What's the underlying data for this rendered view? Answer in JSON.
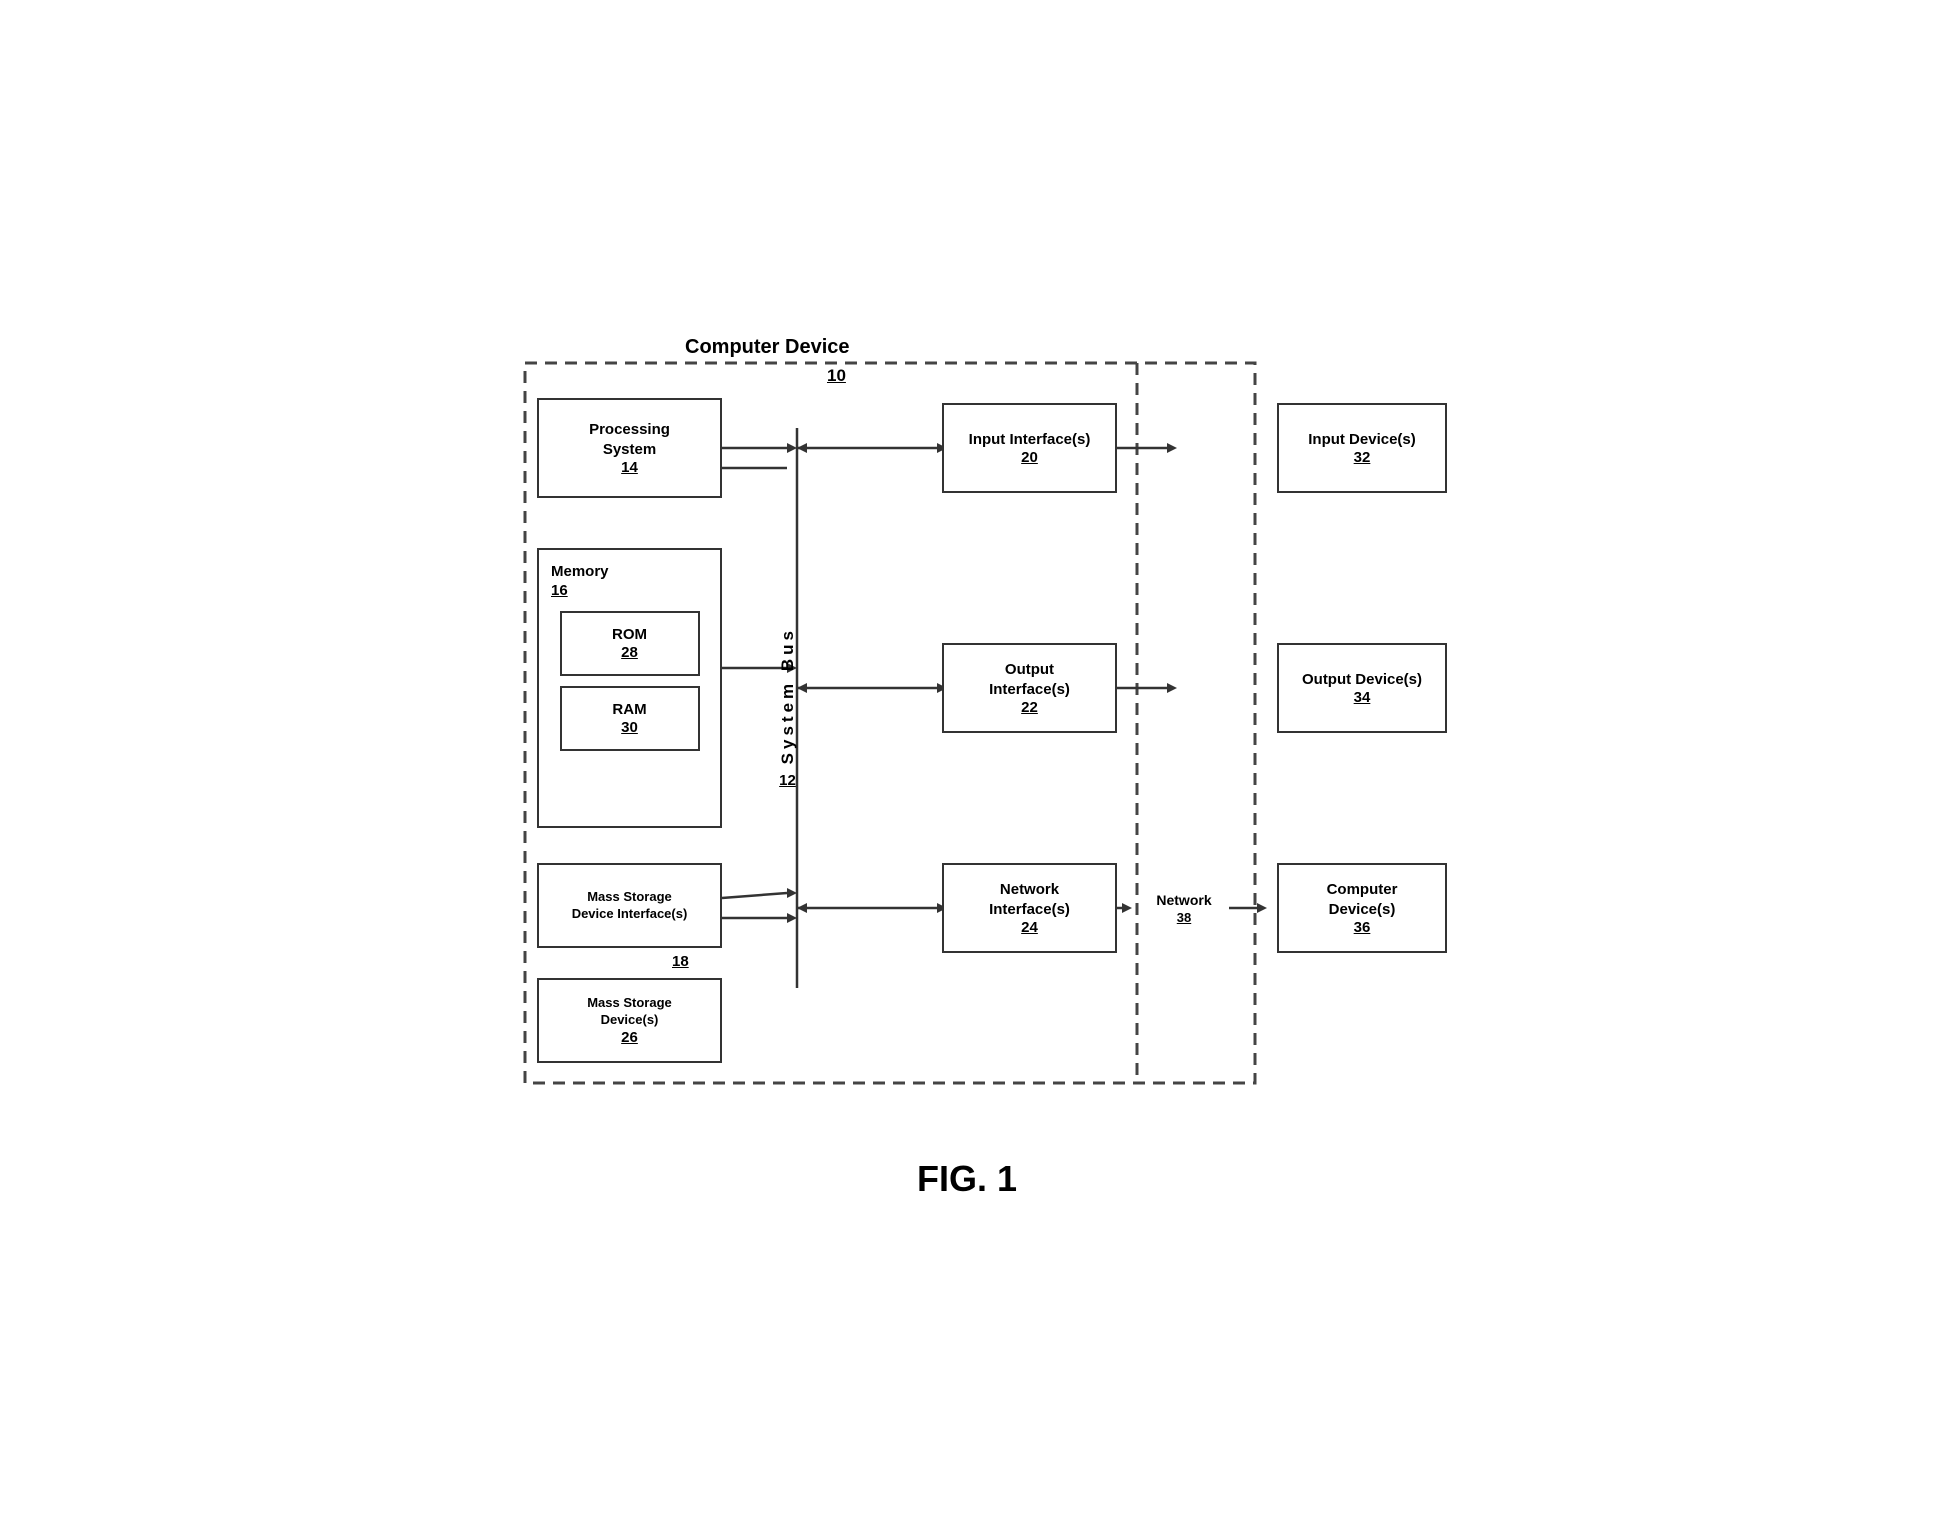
{
  "diagram": {
    "title": "Computer Device",
    "title_num": "10",
    "fig_caption": "FIG. 1",
    "boxes": {
      "processing_system": {
        "label": "Processing System",
        "num": "14"
      },
      "memory": {
        "label": "Memory",
        "num": "16"
      },
      "rom": {
        "label": "ROM",
        "num": "28"
      },
      "ram": {
        "label": "RAM",
        "num": "30"
      },
      "mass_storage_interface": {
        "label": "Mass Storage Device Interface(s)",
        "num": "18"
      },
      "mass_storage_device": {
        "label": "Mass Storage Device(s)",
        "num": "26"
      },
      "system_bus": {
        "label": "System Bus",
        "num": "12"
      },
      "input_interface": {
        "label": "Input Interface(s)",
        "num": "20"
      },
      "output_interface": {
        "label": "Output Interface(s)",
        "num": "22"
      },
      "network_interface": {
        "label": "Network Interface(s)",
        "num": "24"
      },
      "network": {
        "label": "Network",
        "num": "38"
      },
      "input_device": {
        "label": "Input Device(s)",
        "num": "32"
      },
      "output_device": {
        "label": "Output Device(s)",
        "num": "34"
      },
      "computer_device": {
        "label": "Computer Device(s)",
        "num": "36"
      }
    }
  }
}
